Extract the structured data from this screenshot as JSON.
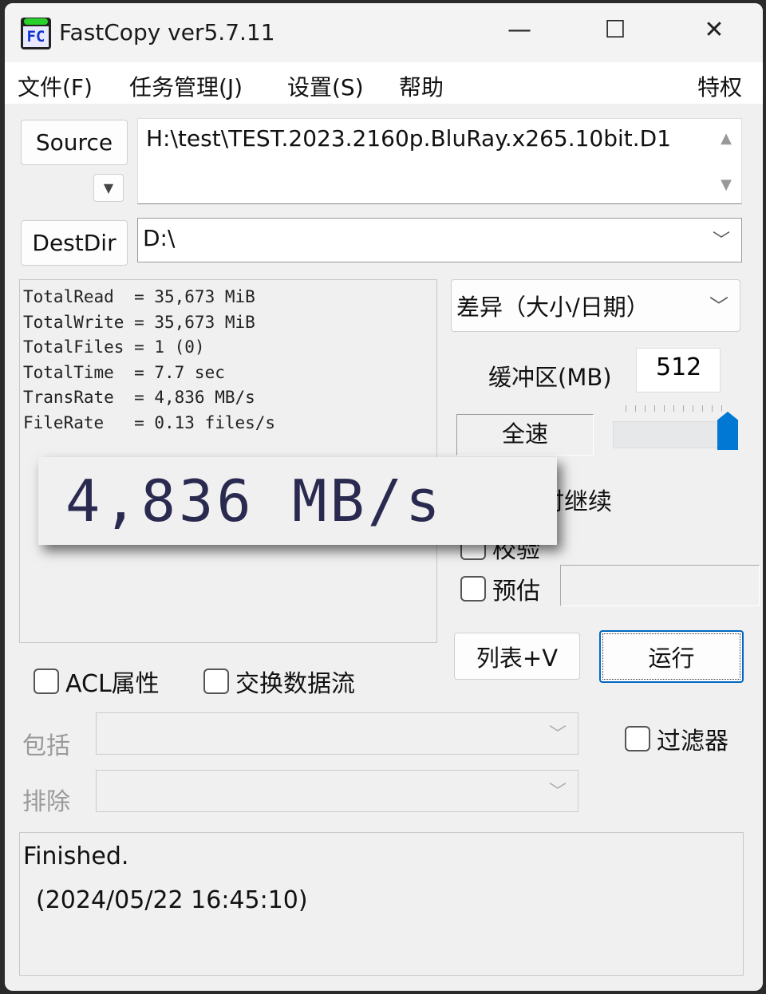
{
  "window": {
    "title": "FastCopy ver5.7.11",
    "logo_text": "FC",
    "minimize": "—",
    "maximize": "☐",
    "close": "✕"
  },
  "menu": {
    "items": [
      "文件(F)",
      "任务管理(J)",
      "设置(S)",
      "帮助"
    ],
    "right": "特权"
  },
  "source": {
    "button": "Source",
    "value": "H:\\test\\TEST.2023.2160p.BluRay.x265.10bit.D1"
  },
  "dest": {
    "button": "DestDir",
    "value": "D:\\"
  },
  "stats": {
    "lines": [
      "TotalRead  = 35,673 MiB",
      "TotalWrite = 35,673 MiB",
      "TotalFiles = 1 (0)",
      "TotalTime  = 7.7 sec",
      "TransRate  = 4,836 MB/s",
      "FileRate   = 0.13 files/s"
    ]
  },
  "overlay": {
    "speed": "4,836 MB/s"
  },
  "mode": {
    "selected": "差异（大小/日期）"
  },
  "buffer": {
    "label": "缓冲区(MB)",
    "value": "512"
  },
  "speed": {
    "button": "全速",
    "slider_level": 1.0
  },
  "options": {
    "continue_on_error": "出错时继续",
    "verify": "校验",
    "estimate": "预估",
    "acl": "ACL属性",
    "ads": "交换数据流",
    "filter": "过滤器"
  },
  "actions": {
    "list": "列表+V",
    "run": "运行"
  },
  "filters": {
    "include_label": "包括",
    "exclude_label": "排除",
    "include_value": "",
    "exclude_value": ""
  },
  "status": {
    "line1": "Finished.",
    "line2": "(2024/05/22 16:45:10)"
  },
  "colors": {
    "slider_thumb": "#0078d4"
  }
}
